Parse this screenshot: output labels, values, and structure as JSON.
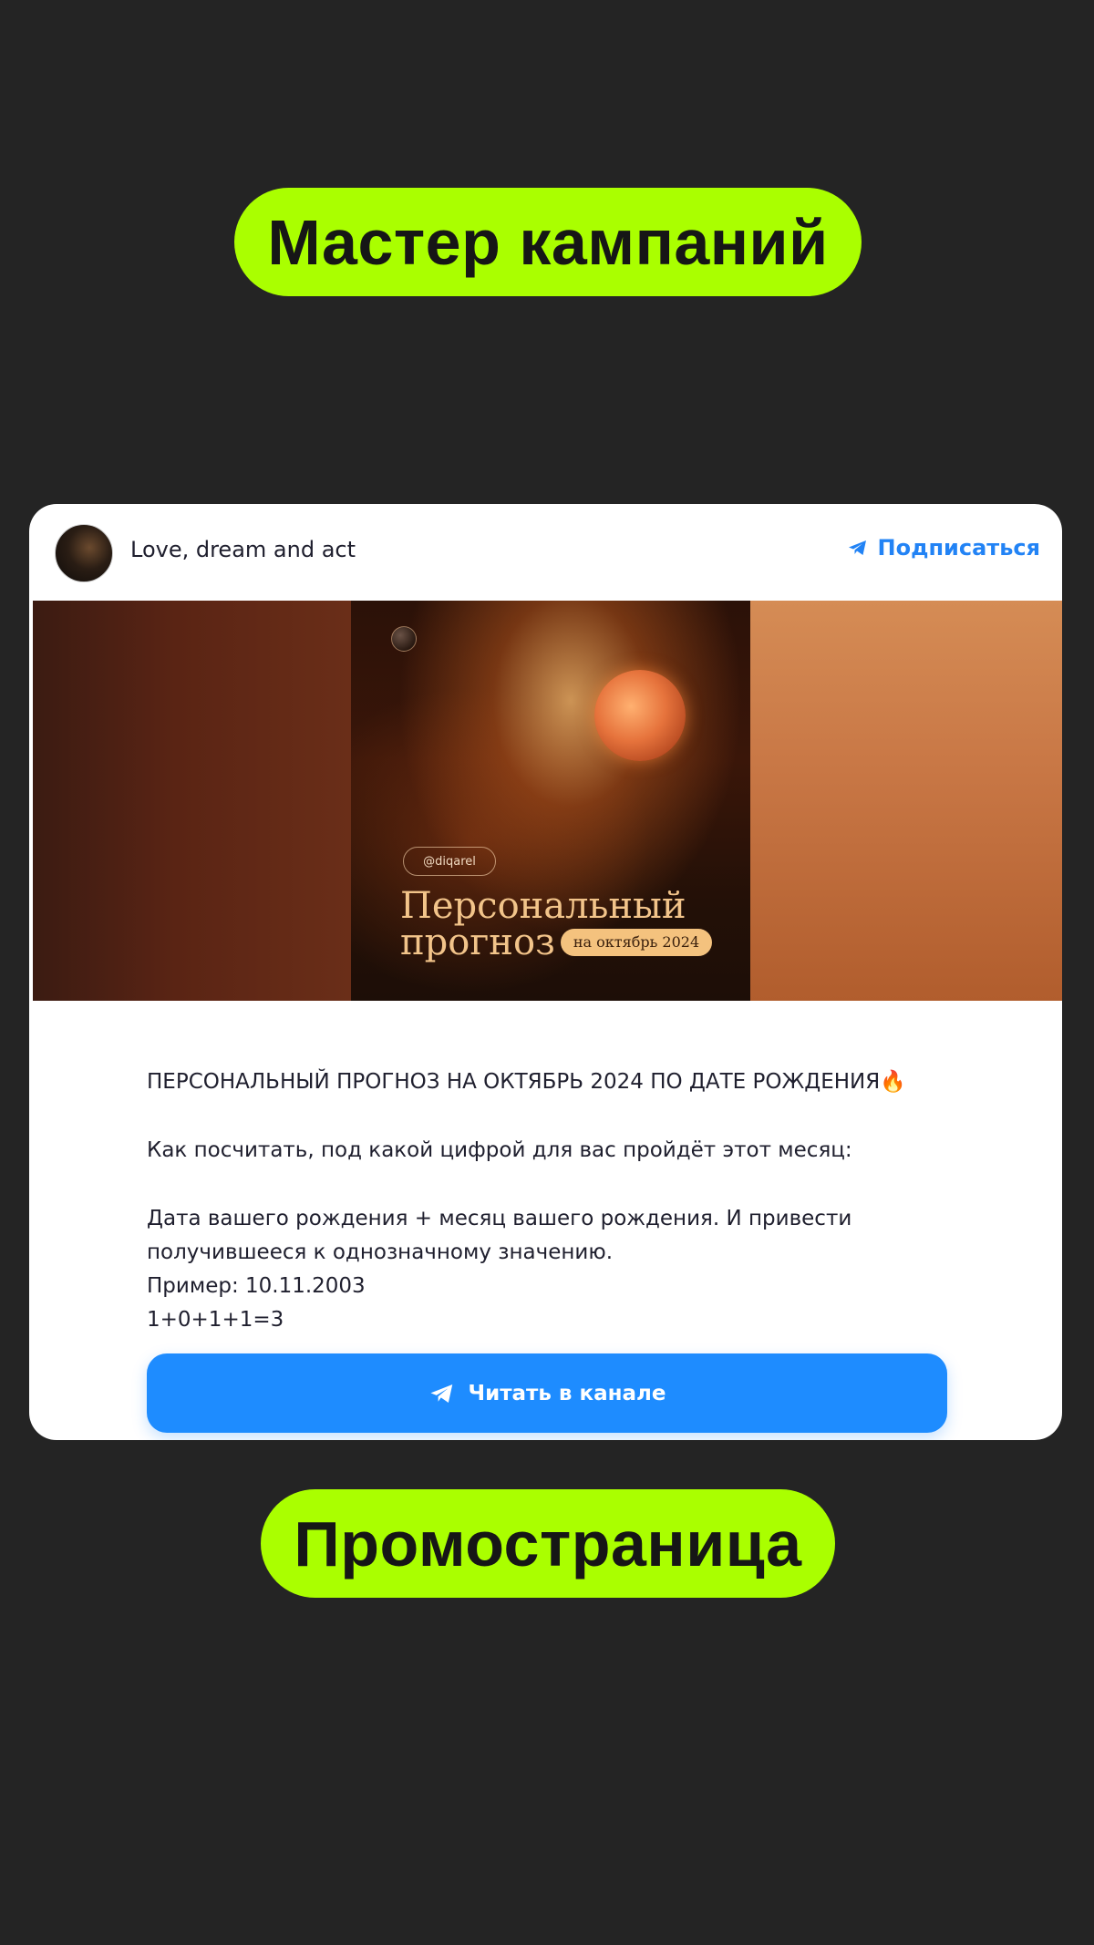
{
  "top_label": "Мастер кампаний",
  "bottom_label": "Промостраница",
  "card": {
    "channel_name": "Love, dream and act",
    "subscribe_label": "Подписаться",
    "banner": {
      "handle": "@diqarel",
      "title_line1": "Персональный",
      "title_line2": "прогноз",
      "date_badge": "на октябрь 2024"
    },
    "post": {
      "heading": "ПЕРСОНАЛЬНЫЙ ПРОГНОЗ НА ОКТЯБРЬ 2024 ПО ДАТЕ РОЖДЕНИЯ🔥",
      "line1": "Как посчитать, под какой цифрой для вас пройдёт этот месяц:",
      "line2": "Дата вашего рождения + месяц вашего рождения. И привести",
      "line3": "получившееся к однозначному значению.",
      "line4": "Пример: 10.11.2003",
      "line5": "1+0+1+1=3"
    },
    "read_button_label": "Читать в канале"
  },
  "colors": {
    "background": "#242424",
    "pill": "#aaff00",
    "accent": "#1e8cff"
  }
}
